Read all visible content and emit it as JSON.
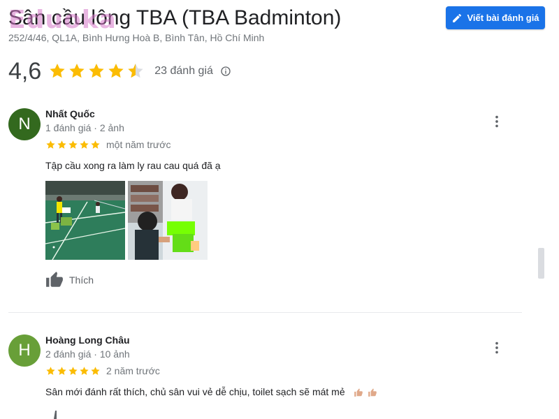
{
  "place": {
    "title": "Sân cầu lông TBA (TBA Badminton)",
    "address": "252/4/46, QL1A, Bình Hưng Hoà B, Bình Tân, Hồ Chí Minh",
    "rating": "4,6",
    "rating_value": 4.6,
    "review_count_text": "23 đánh giá"
  },
  "watermark": {
    "text": "Eduoka"
  },
  "actions": {
    "write_review_label": "Viết bài đánh giá"
  },
  "reviews": [
    {
      "initial": "N",
      "avatar_color": "#33691e",
      "name": "Nhất Quốc",
      "meta": "1 đánh giá · 2 ảnh",
      "stars": 5,
      "time": "một năm trước",
      "text": "Tập cầu xong ra làm ly rau cau quá đã ạ",
      "photos": [
        "badminton-court-photo",
        "players-resting-photo"
      ],
      "like_label": "Thích"
    },
    {
      "initial": "H",
      "avatar_color": "#689f38",
      "name": "Hoàng Long Châu",
      "meta": "2 đánh giá · 10 ảnh",
      "stars": 5,
      "time": "2 năm trước",
      "text": "Sân mới đánh rất thích, chủ sân vui vẻ dễ chịu, toilet sạch sẽ mát mẻ",
      "emojis": [
        "thumbs-up-emoji",
        "thumbs-up-emoji"
      ]
    }
  ],
  "colors": {
    "star": "#fbbc04",
    "star_empty": "#dadce0",
    "accent": "#1a73e8"
  },
  "icons": [
    "pencil-icon",
    "star-icon",
    "half-star-icon",
    "info-icon",
    "more-vert-icon",
    "thumbs-up-icon"
  ]
}
